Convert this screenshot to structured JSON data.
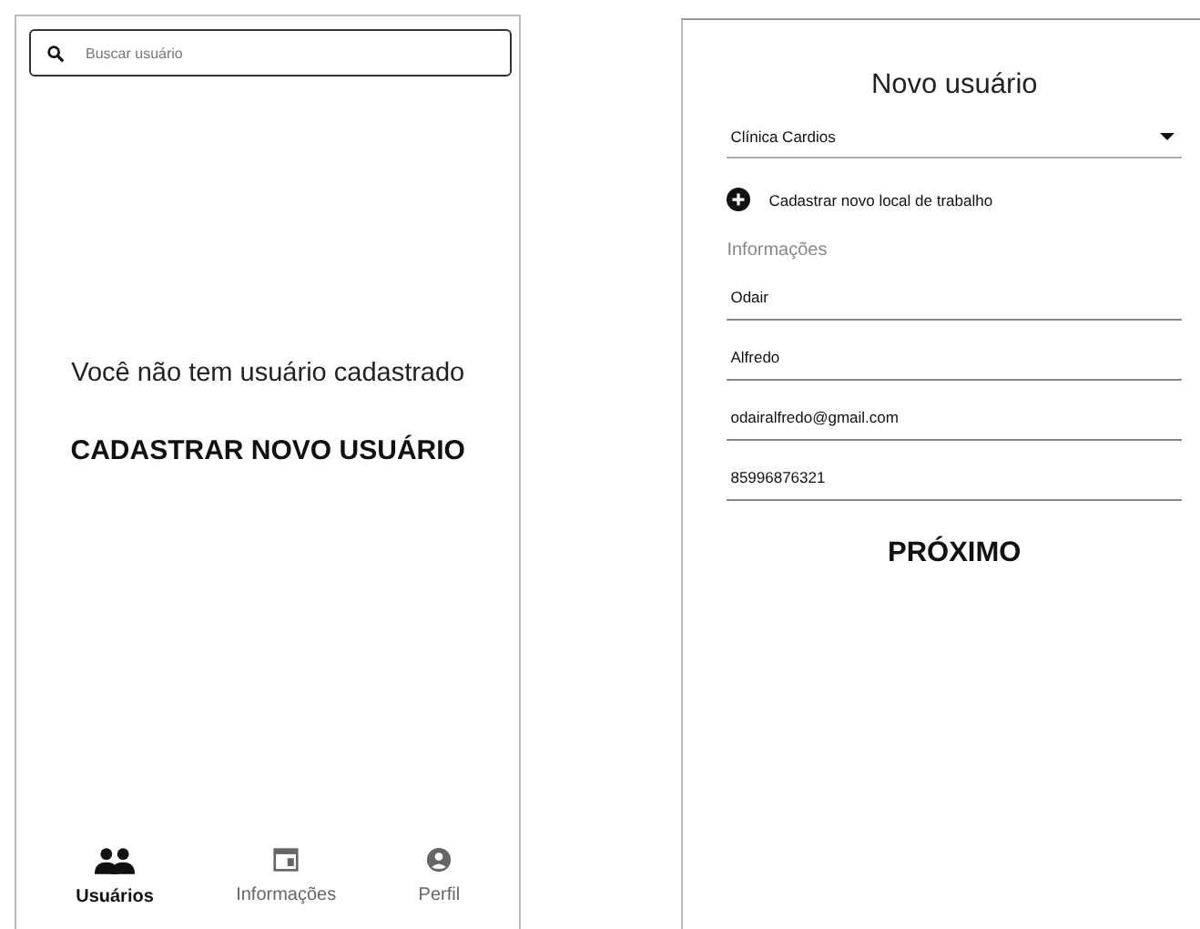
{
  "users_screen": {
    "search": {
      "placeholder": "Buscar usuário"
    },
    "empty_message": "Você não tem usuário cadastrado",
    "register_button": "CADASTRAR NOVO USUÁRIO",
    "bottom_nav": [
      {
        "label": "Usuários",
        "kind": "users",
        "selected": true
      },
      {
        "label": "Informações",
        "kind": "calendar",
        "selected": false
      },
      {
        "label": "Perfil",
        "kind": "profile",
        "selected": false
      }
    ]
  },
  "new_user_screen": {
    "title": "Novo usuário",
    "workplace_select": {
      "value": "Clínica Cardios"
    },
    "add_workplace": "Cadastrar novo local de trabalho",
    "section_label": "Informações",
    "fields": [
      {
        "value": "Odair"
      },
      {
        "value": "Alfredo"
      },
      {
        "value": "odairalfredo@gmail.com"
      },
      {
        "value": "85996876321"
      }
    ],
    "next_button": "PRÓXIMO"
  }
}
